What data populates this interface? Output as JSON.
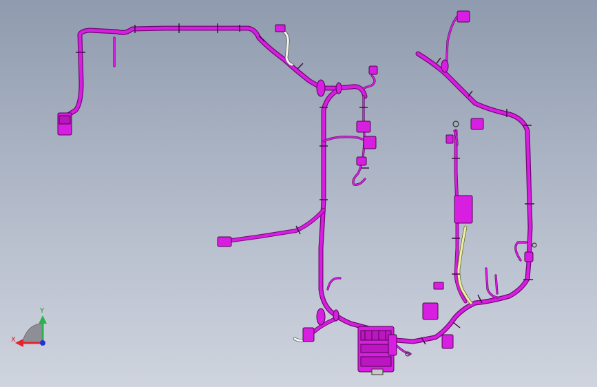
{
  "view": {
    "background_top": "#8f9bae",
    "background_bottom": "#cfd4de",
    "harness_color": "#d81ee0",
    "harness_edge_color": "#6e0a73"
  },
  "triad": {
    "x_label": "X",
    "y_label": "Y",
    "x_color": "#e0262a",
    "y_color": "#2bb24c",
    "z_color": "#2233d6"
  }
}
